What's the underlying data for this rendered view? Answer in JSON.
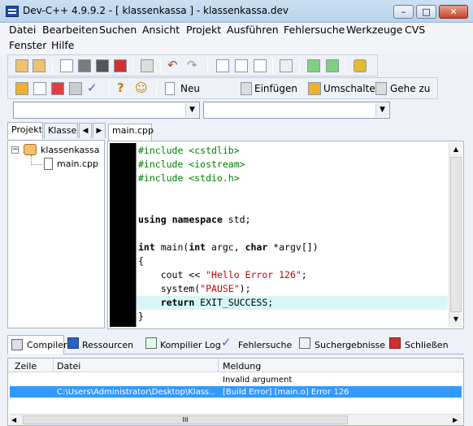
{
  "window": {
    "title": "Dev-C++ 4.9.9.2  -  [ klassenkassa ] - klassenkassa.dev",
    "minimize_glyph": "–",
    "maximize_glyph": "□",
    "close_glyph": "✕"
  },
  "menu": {
    "items": [
      "Datei",
      "Bearbeiten",
      "Suchen",
      "Ansicht",
      "Projekt",
      "Ausführen",
      "Fehlersuche",
      "Werkzeuge",
      "CVS",
      "Fenster",
      "Hilfe"
    ]
  },
  "toolbar2": {
    "new_label": "Neu",
    "insert_label": "Einfügen",
    "toggle_label": "Umschalten",
    "goto_label": "Gehe zu"
  },
  "left_panel": {
    "tabs": [
      "Projekt",
      "Klasse"
    ],
    "project_name": "klassenkassa",
    "file_name": "main.cpp"
  },
  "editor": {
    "tab_label": "main.cpp",
    "lines": [
      {
        "parts": [
          {
            "t": "#include <cstdlib>",
            "c": "pp"
          }
        ]
      },
      {
        "parts": [
          {
            "t": "#include <iostream>",
            "c": "pp"
          }
        ]
      },
      {
        "parts": [
          {
            "t": "#include <stdio.h>",
            "c": "pp"
          }
        ]
      },
      {
        "parts": []
      },
      {
        "parts": []
      },
      {
        "parts": [
          {
            "t": "using",
            "c": "kw"
          },
          {
            "t": " ",
            "c": ""
          },
          {
            "t": "namespace",
            "c": "kw"
          },
          {
            "t": " std;",
            "c": ""
          }
        ]
      },
      {
        "parts": []
      },
      {
        "parts": [
          {
            "t": "int",
            "c": "kw"
          },
          {
            "t": " main(",
            "c": ""
          },
          {
            "t": "int",
            "c": "kw"
          },
          {
            "t": " argc, ",
            "c": ""
          },
          {
            "t": "char",
            "c": "kw"
          },
          {
            "t": " *argv[])",
            "c": ""
          }
        ]
      },
      {
        "parts": [
          {
            "t": "{",
            "c": ""
          }
        ]
      },
      {
        "parts": [
          {
            "t": "    cout << ",
            "c": ""
          },
          {
            "t": "\"Hello Error 126\"",
            "c": "str"
          },
          {
            "t": ";",
            "c": ""
          }
        ]
      },
      {
        "parts": [
          {
            "t": "    system(",
            "c": ""
          },
          {
            "t": "\"PAUSE\"",
            "c": "str"
          },
          {
            "t": ");",
            "c": ""
          }
        ]
      },
      {
        "parts": [
          {
            "t": "    ",
            "c": ""
          },
          {
            "t": "return",
            "c": "kw"
          },
          {
            "t": " EXIT_SUCCESS;",
            "c": ""
          }
        ]
      },
      {
        "parts": [
          {
            "t": "}",
            "c": ""
          }
        ]
      }
    ],
    "highlighted_line": 11,
    "highlight_color": "#d8f6f8"
  },
  "bottom": {
    "tabs": [
      "Compiler",
      "Ressourcen",
      "Kompilier Log",
      "Fehlersuche",
      "Suchergebnisse",
      "Schließen"
    ],
    "columns": [
      "Zeile",
      "Datei",
      "Meldung"
    ],
    "rows": [
      {
        "line": "",
        "file": "",
        "message": "Invalid argument"
      },
      {
        "line": "",
        "file": "C:\\Users\\Administrator\\Desktop\\Klass...",
        "message": "[Build Error]  [main.o] Error 126"
      }
    ],
    "selected_color": "#3399ff",
    "scroll_grip": "III"
  }
}
